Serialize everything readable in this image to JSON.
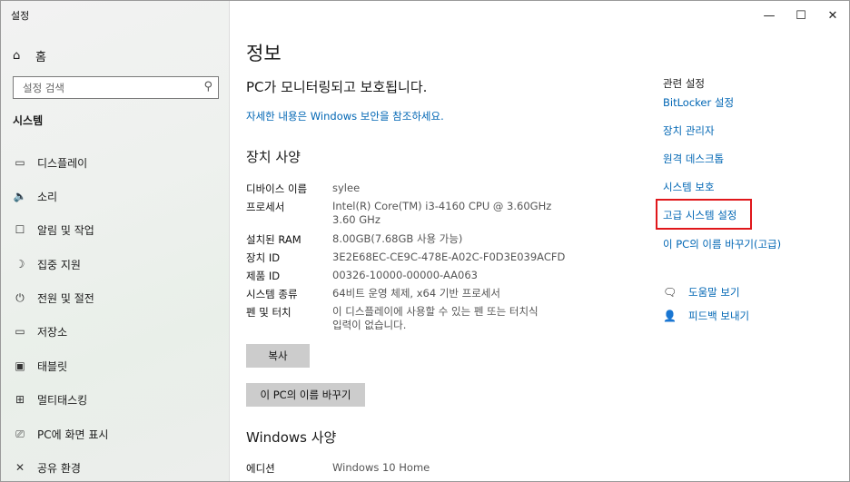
{
  "window": {
    "title": "설정",
    "min_glyph": "—",
    "max_glyph": "☐",
    "close_glyph": "✕"
  },
  "sidebar": {
    "home": {
      "label": "홈",
      "icon": "home-icon",
      "glyph": "⌂"
    },
    "search": {
      "placeholder": "설정 검색",
      "icon": "search-icon",
      "glyph": "⚲"
    },
    "section": "시스템",
    "items": [
      {
        "label": "디스플레이",
        "icon": "display-icon",
        "glyph": "▭"
      },
      {
        "label": "소리",
        "icon": "sound-icon",
        "glyph": "🔈"
      },
      {
        "label": "알림 및 작업",
        "icon": "notification-icon",
        "glyph": "☐"
      },
      {
        "label": "집중 지원",
        "icon": "moon-icon",
        "glyph": "☽"
      },
      {
        "label": "전원 및 절전",
        "icon": "power-icon",
        "glyph": "⏻"
      },
      {
        "label": "저장소",
        "icon": "storage-icon",
        "glyph": "▭"
      },
      {
        "label": "태블릿",
        "icon": "tablet-icon",
        "glyph": "▣"
      },
      {
        "label": "멀티태스킹",
        "icon": "multitasking-icon",
        "glyph": "⊞"
      },
      {
        "label": "PC에 화면 표시",
        "icon": "project-icon",
        "glyph": "⎚"
      },
      {
        "label": "공유 환경",
        "icon": "shared-icon",
        "glyph": "✕"
      }
    ]
  },
  "main": {
    "title": "정보",
    "protection_status": "PC가 모니터링되고 보호됩니다.",
    "security_link": "자세한 내용은 Windows 보안을 참조하세요.",
    "device_spec_heading": "장치 사양",
    "specs": [
      {
        "key": "디바이스 이름",
        "value": "sylee"
      },
      {
        "key": "프로세서",
        "value": "Intel(R) Core(TM) i3-4160 CPU @ 3.60GHz",
        "value2": "3.60 GHz"
      },
      {
        "key": "설치된 RAM",
        "value": "8.00GB(7.68GB 사용 가능)"
      },
      {
        "key": "장치 ID",
        "value": "3E2E68EC-CE9C-478E-A02C-F0D3E039ACFD"
      },
      {
        "key": "제품 ID",
        "value": "00326-10000-00000-AA063"
      },
      {
        "key": "시스템 종류",
        "value": "64비트 운영 체제, x64 기반 프로세서"
      },
      {
        "key": "펜 및 터치",
        "value": "이 디스플레이에 사용할 수 있는 펜 또는 터치식",
        "value2": "입력이 없습니다."
      }
    ],
    "copy_button": "복사",
    "rename_button": "이 PC의 이름 바꾸기",
    "windows_spec_heading": "Windows 사양",
    "edition": {
      "key": "에디션",
      "value": "Windows 10 Home"
    }
  },
  "related": {
    "title": "관련 설정",
    "links": [
      "BitLocker 설정",
      "장치 관리자",
      "원격 데스크톱",
      "시스템 보호",
      "고급 시스템 설정",
      "이 PC의 이름 바꾸기(고급)"
    ],
    "help": {
      "label": "도움말 보기",
      "icon": "help-icon",
      "glyph": "🗨"
    },
    "feedback": {
      "label": "피드백 보내기",
      "icon": "feedback-icon",
      "glyph": "👤"
    },
    "highlight_color": "#e0171b",
    "link_color": "#0066b4"
  }
}
